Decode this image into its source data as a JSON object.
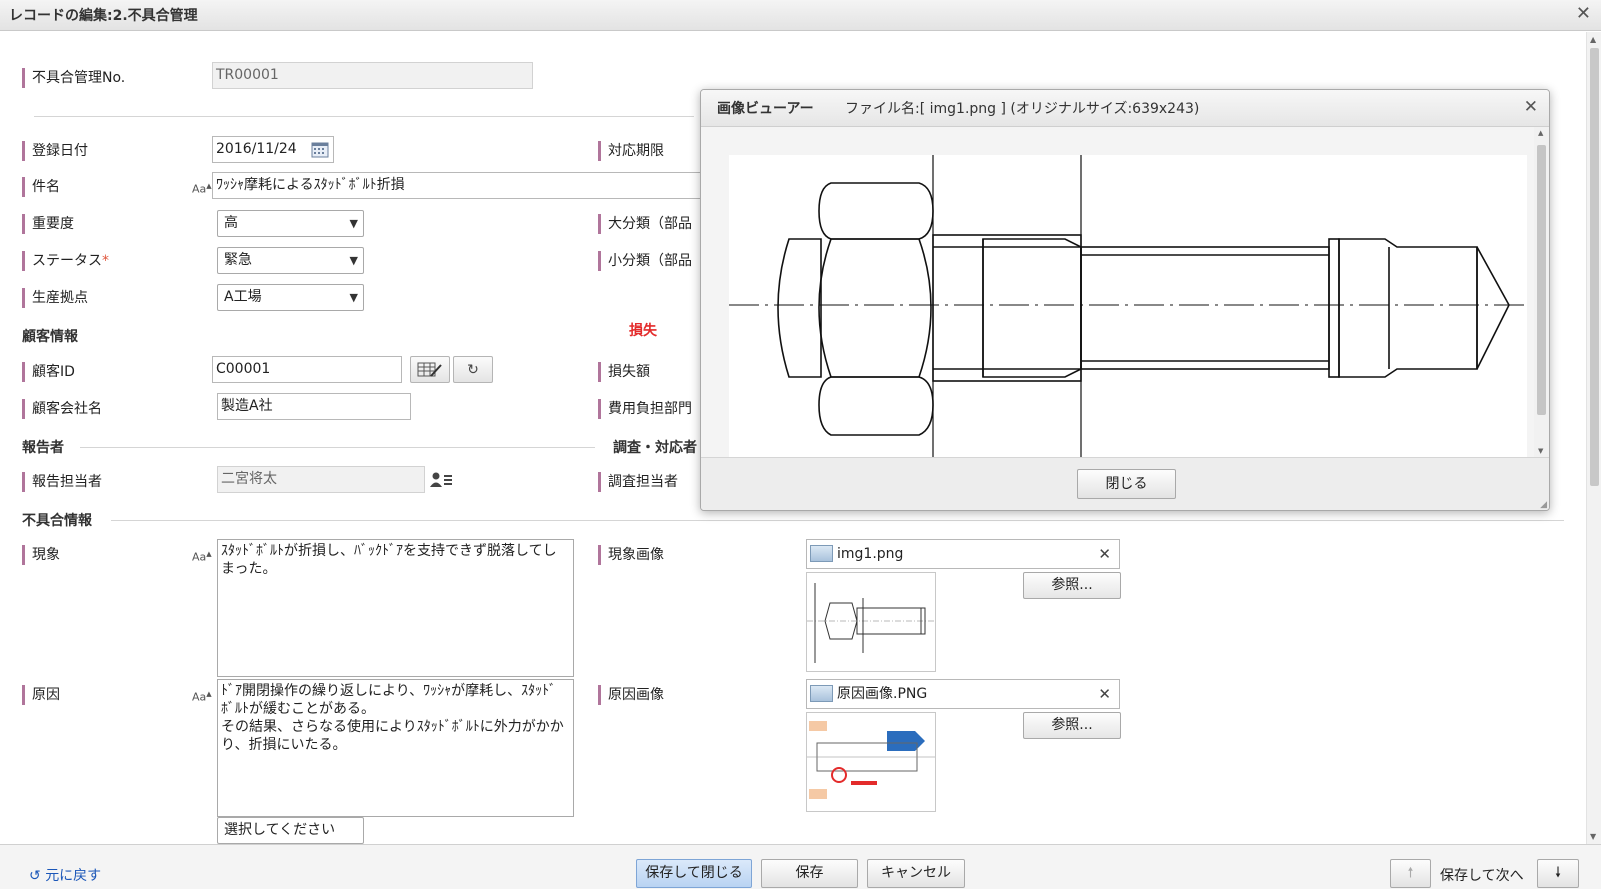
{
  "window": {
    "title": "レコードの編集:2.不具合管理",
    "close_glyph": "✕"
  },
  "form": {
    "record_no": {
      "label": "不具合管理No.",
      "value": "TR00001"
    },
    "registered_date": {
      "label": "登録日付",
      "value": "2016/11/24"
    },
    "response_due": {
      "label": "対応期限"
    },
    "subject": {
      "label": "件名",
      "value": "ﾜｯｼｬ摩耗によるｽﾀｯﾄﾞﾎﾞﾙﾄ折損"
    },
    "importance": {
      "label": "重要度",
      "value": "高"
    },
    "major_category": {
      "label": "大分類（部品"
    },
    "status": {
      "label": "ステータス",
      "required_mark": "*",
      "value": "緊急"
    },
    "minor_category": {
      "label": "小分類（部品"
    },
    "plant": {
      "label": "生産拠点",
      "value": "A工場"
    },
    "customer_section": "顧客情報",
    "loss_section": "損失",
    "customer_id": {
      "label": "顧客ID",
      "value": "C00001"
    },
    "loss_amount": {
      "label": "損失額"
    },
    "customer_company": {
      "label": "顧客会社名",
      "value": "製造A社"
    },
    "cost_dept": {
      "label": "費用負担部門"
    },
    "reporter_section": "報告者",
    "investigation_section": "調査・対応者",
    "reporter": {
      "label": "報告担当者",
      "value": "二宮将太"
    },
    "investigator": {
      "label": "調査担当者"
    },
    "defect_section": "不具合情報",
    "phenomenon": {
      "label": "現象",
      "value": "ｽﾀｯﾄﾞﾎﾞﾙﾄが折損し、ﾊﾞｯｸﾄﾞｱを支持できず脱落してしまった。"
    },
    "phenomenon_image": {
      "label": "現象画像",
      "file": "img1.png",
      "browse": "参照..."
    },
    "cause": {
      "label": "原因",
      "value": "ﾄﾞｱ開閉操作の繰り返しにより、ﾜｯｼｬが摩耗し、ｽﾀｯﾄﾞﾎﾞﾙﾄが緩むことがある。\nその結果、さらなる使用によりｽﾀｯﾄﾞﾎﾞﾙﾄに外力がかかり、折損にいたる。"
    },
    "cause_image": {
      "label": "原因画像",
      "file": "原因画像.PNG",
      "browse": "参照..."
    },
    "partial_select": "選択してください"
  },
  "viewer": {
    "title": "画像ビューアー",
    "file_info": "ファイル名:[ img1.png ] (オリジナルサイズ:639x243)",
    "close_button": "閉じる"
  },
  "footer": {
    "back": "元に戻す",
    "save_close": "保存して閉じる",
    "save": "保存",
    "cancel": "キャンセル",
    "save_next": "保存して次へ"
  }
}
